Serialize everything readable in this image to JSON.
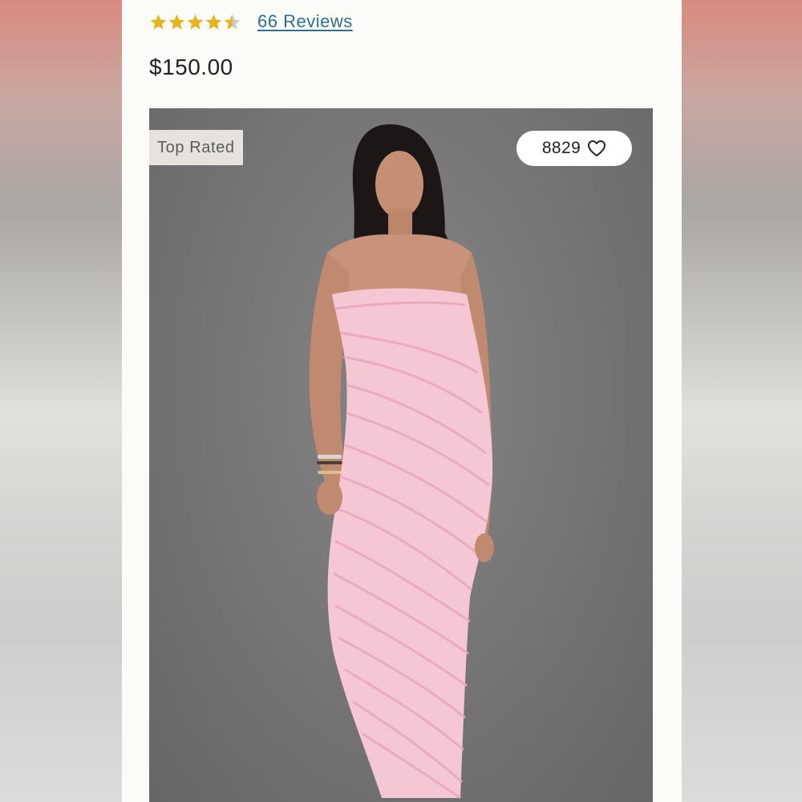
{
  "rating": {
    "value": 4.5,
    "max": 5,
    "reviews_label": "66 Reviews",
    "star_color": "#e6b422"
  },
  "price": "$150.00",
  "product_image": {
    "badge": "Top Rated",
    "favorites_count": "8829",
    "dress_color": "#f5c6d3",
    "background_color": "#777777"
  }
}
